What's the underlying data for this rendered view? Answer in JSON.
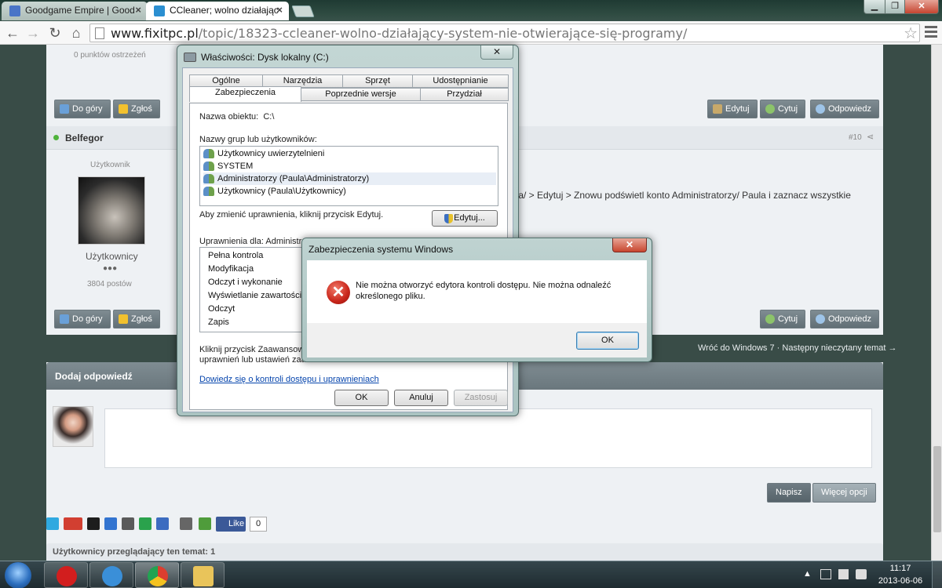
{
  "browser": {
    "tabs": [
      {
        "title": "Goodgame Empire | Good",
        "close": "×",
        "icon_color": "#4a74c7"
      },
      {
        "title": "CCleaner; wolno działając",
        "close": "×",
        "icon_color": "#2b8fd1"
      }
    ],
    "window_controls": {
      "minimize": "▁",
      "maximize": "❐",
      "close": "✕"
    },
    "url_host": "www.fixitpc.pl",
    "url_path": "/topic/18323-ccleaner-wolno-działający-system-nie-otwierające-się-programy/"
  },
  "forum": {
    "warn_points": "0 punktów ostrzeżeń",
    "buttons": {
      "top": "Do góry",
      "report": "Zgłoś",
      "edit": "Edytuj",
      "quote": "Cytuj",
      "reply": "Odpowiedz",
      "write": "Napisz",
      "more_options": "Więcej opcji"
    },
    "post": {
      "author": "Belfegor",
      "post_number": "#10",
      "rank_title": "Użytkownik",
      "group": "Użytkownicy",
      "pips": "●●●",
      "post_count": "3804 postów",
      "content_fragment": "ula/ > Edytuj > Znowu podświetl konto Administratorzy/ Paula i zaznacz wszystkie"
    },
    "topic_nav": {
      "back": "Wróć do Windows 7",
      "sep": "·",
      "next": "Następny nieczytany temat →"
    },
    "add_reply_title": "Dodaj odpowiedź",
    "like": {
      "label": "Like",
      "count": "0"
    },
    "viewers": "Użytkownicy przeglądający ten temat: 1"
  },
  "properties_dialog": {
    "title": "Właściwości: Dysk lokalny (C:)",
    "close": "✕",
    "tabs_row1": [
      "Ogólne",
      "Narzędzia",
      "Sprzęt",
      "Udostępnianie"
    ],
    "tabs_row2": [
      "Zabezpieczenia",
      "Poprzednie wersje",
      "Przydział"
    ],
    "object_label": "Nazwa obiektu:",
    "object_value": "C:\\",
    "groups_label": "Nazwy grup lub użytkowników:",
    "groups": [
      "Użytkownicy uwierzytelnieni",
      "SYSTEM",
      "Administratorzy (Paula\\Administratorzy)",
      "Użytkownicy (Paula\\Użytkownicy)"
    ],
    "change_hint": "Aby zmienić uprawnienia, kliknij przycisk Edytuj.",
    "edit_button": "Edytuj...",
    "perms_label": "Uprawnienia dla: Administrato",
    "perms_col_partial": "Z        O",
    "permissions": [
      "Pełna kontrola",
      "Modyfikacja",
      "Odczyt i wykonanie",
      "Wyświetlanie zawartości fol",
      "Odczyt",
      "Zapis"
    ],
    "advanced_hint_1": "Kliknij przycisk Zaawansowan",
    "advanced_hint_2": "uprawnień lub ustawień zaaw",
    "learn_link": "Dowiedz się o kontroli dostępu i uprawnieniach",
    "ok": "OK",
    "cancel": "Anuluj",
    "apply": "Zastosuj"
  },
  "error_dialog": {
    "title": "Zabezpieczenia systemu Windows",
    "close": "✕",
    "message_line1": "Nie można otworzyć edytora kontroli dostępu. Nie można odnaleźć",
    "message_line2": "określonego pliku.",
    "ok": "OK"
  },
  "taskbar": {
    "time": "11:17",
    "date": "2013-06-06",
    "apps": [
      {
        "name": "opera",
        "color": "#d21e1e"
      },
      {
        "name": "itunes",
        "color": "#3a8fd8"
      },
      {
        "name": "chrome",
        "color": "#e8b323"
      },
      {
        "name": "explorer",
        "color": "#e9c45a"
      }
    ]
  }
}
